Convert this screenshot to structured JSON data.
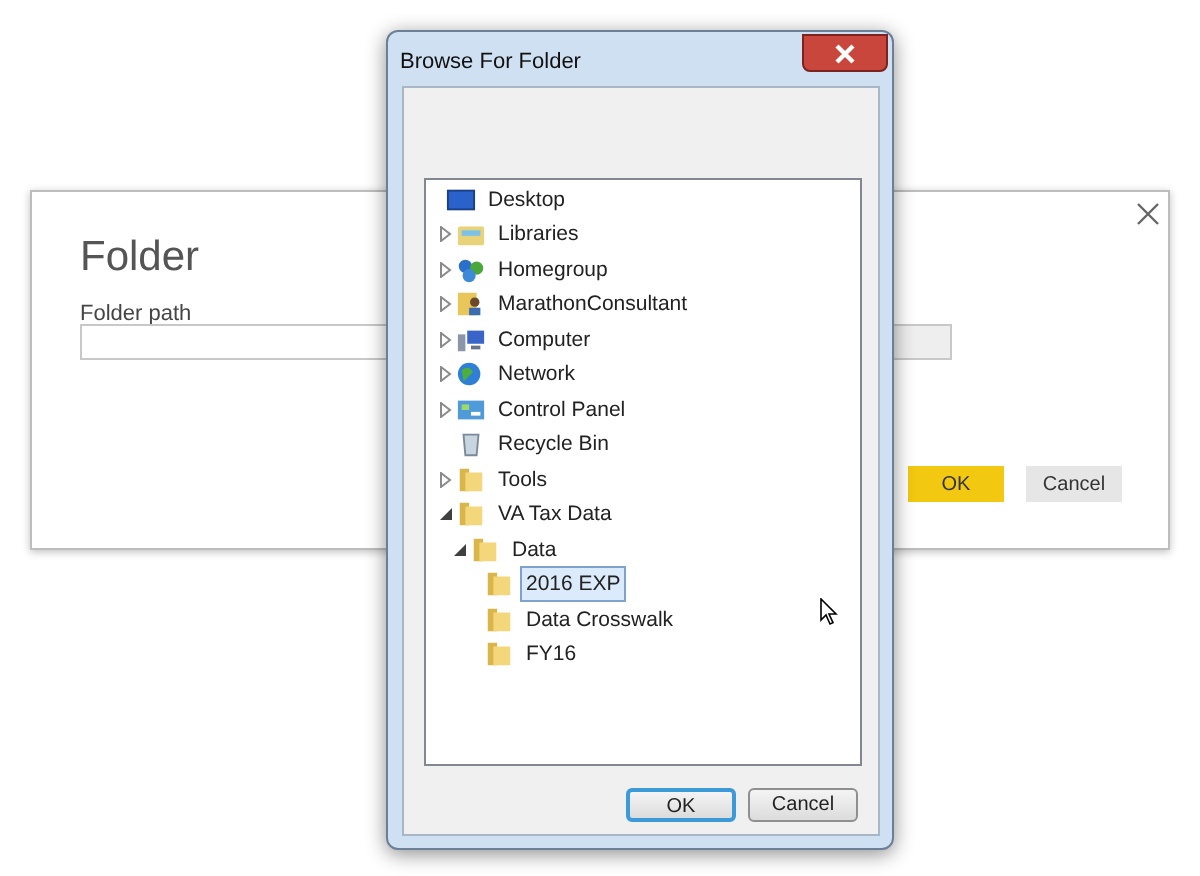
{
  "back_dialog": {
    "title": "Folder",
    "field_label": "Folder path",
    "buttons": [
      {
        "label": "OK",
        "kind": "primary"
      },
      {
        "label": "Cancel",
        "kind": "secondary"
      }
    ]
  },
  "dialog": {
    "title": "Browse For Folder",
    "tree": [
      {
        "label": "Desktop",
        "kind": "desktop",
        "selected": false,
        "children": [
          {
            "label": "Libraries",
            "kind": "libraries",
            "expanded": false,
            "selected": false
          },
          {
            "label": "Homegroup",
            "kind": "homegroup",
            "expanded": false,
            "selected": false
          },
          {
            "label": "MarathonConsultant",
            "kind": "user",
            "expanded": false,
            "selected": false
          },
          {
            "label": "Computer",
            "kind": "computer",
            "expanded": false,
            "selected": false
          },
          {
            "label": "Network",
            "kind": "network",
            "expanded": false,
            "selected": false
          },
          {
            "label": "Control Panel",
            "kind": "control-panel",
            "expanded": false,
            "selected": false
          },
          {
            "label": "Recycle Bin",
            "kind": "recycle-bin",
            "selected": false
          },
          {
            "label": "Tools",
            "kind": "folder",
            "expanded": false,
            "selected": false
          },
          {
            "label": "VA Tax Data",
            "kind": "folder",
            "expanded": true,
            "selected": false,
            "children": [
              {
                "label": "Data",
                "kind": "folder",
                "expanded": true,
                "selected": false,
                "children": [
                  {
                    "label": "2016 EXP",
                    "kind": "folder",
                    "selected": true
                  },
                  {
                    "label": "Data Crosswalk",
                    "kind": "folder",
                    "selected": false
                  },
                  {
                    "label": "FY16",
                    "kind": "folder",
                    "selected": false
                  }
                ]
              }
            ]
          }
        ]
      }
    ],
    "buttons": [
      {
        "label": "OK",
        "kind": "default"
      },
      {
        "label": "Cancel",
        "kind": "normal"
      }
    ]
  }
}
